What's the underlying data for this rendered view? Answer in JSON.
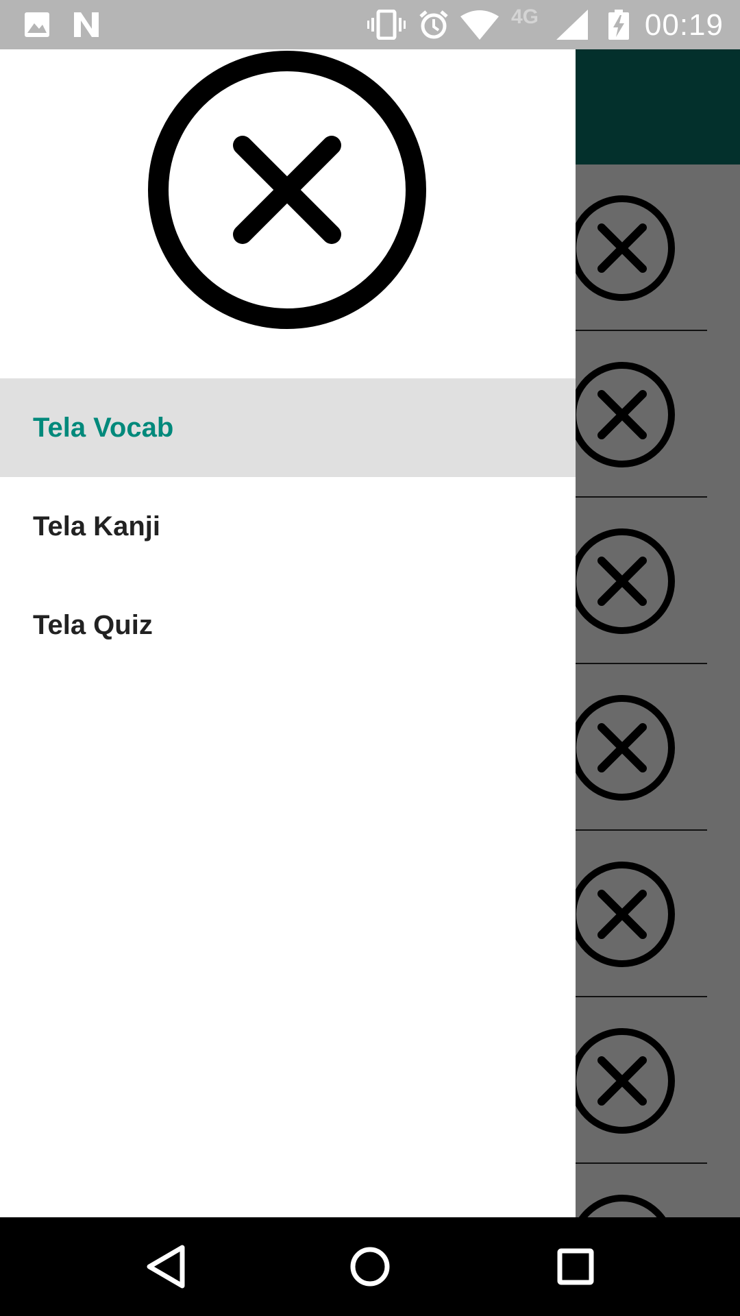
{
  "status_bar": {
    "time": "00:19",
    "network_type": "4G",
    "icons": [
      "image-icon",
      "n-logo-icon",
      "vibrate-icon",
      "alarm-icon",
      "wifi-icon",
      "signal-icon",
      "battery-charging-icon"
    ]
  },
  "drawer": {
    "header_icon": "close-circle-icon",
    "menu": [
      {
        "label": "Tela Vocab",
        "selected": true
      },
      {
        "label": "Tela Kanji",
        "selected": false
      },
      {
        "label": "Tela Quiz",
        "selected": false
      }
    ]
  },
  "background_list": {
    "row_icon": "close-circle-icon",
    "rows": 7
  },
  "nav_bar": {
    "buttons": [
      "back-icon",
      "home-icon",
      "recents-icon"
    ]
  },
  "colors": {
    "status_bar": "#b5b5b5",
    "app_bar": "#03302c",
    "scrim": "#6a6a6a",
    "accent": "#00897b",
    "selected_bg": "#e0e0e0"
  }
}
